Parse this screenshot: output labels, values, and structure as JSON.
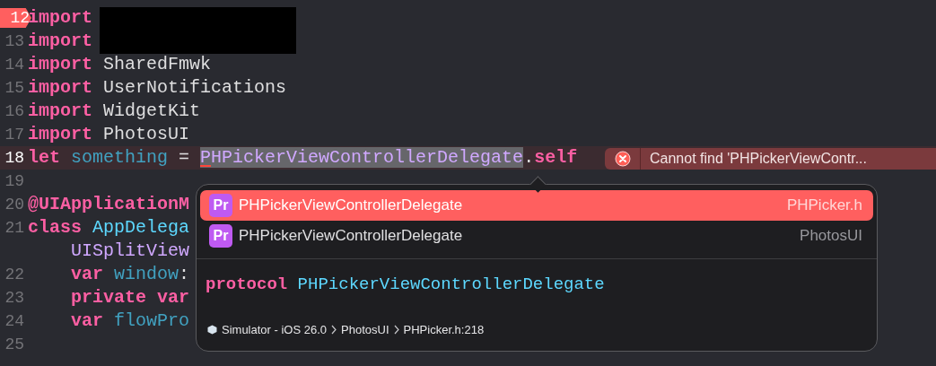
{
  "editor": {
    "lines": [
      {
        "number": "12",
        "marker": true,
        "highlighted": false,
        "tokens": [
          {
            "text": "import",
            "kind": "keyword"
          }
        ]
      },
      {
        "number": "13",
        "marker": false,
        "highlighted": false,
        "tokens": [
          {
            "text": "import",
            "kind": "keyword"
          }
        ]
      },
      {
        "number": "14",
        "marker": false,
        "highlighted": false,
        "tokens": [
          {
            "text": "import",
            "kind": "keyword"
          },
          {
            "text": " SharedFmwk",
            "kind": "plain"
          }
        ]
      },
      {
        "number": "15",
        "marker": false,
        "highlighted": false,
        "tokens": [
          {
            "text": "import",
            "kind": "keyword"
          },
          {
            "text": " UserNotifications",
            "kind": "plain"
          }
        ]
      },
      {
        "number": "16",
        "marker": false,
        "highlighted": false,
        "tokens": [
          {
            "text": "import",
            "kind": "keyword"
          },
          {
            "text": " WidgetKit",
            "kind": "plain"
          }
        ]
      },
      {
        "number": "17",
        "marker": false,
        "highlighted": false,
        "tokens": [
          {
            "text": "import",
            "kind": "keyword"
          },
          {
            "text": " PhotosUI",
            "kind": "plain"
          }
        ]
      },
      {
        "number": "18",
        "marker": false,
        "highlighted": true,
        "tokens": [
          {
            "text": "let",
            "kind": "keyword"
          },
          {
            "text": " something",
            "kind": "identifier"
          },
          {
            "text": " = ",
            "kind": "plain"
          },
          {
            "text": "PHPickerViewControllerDelegate",
            "kind": "selected-type"
          },
          {
            "text": ".",
            "kind": "plain"
          },
          {
            "text": "self",
            "kind": "keyword"
          }
        ]
      },
      {
        "number": "19",
        "marker": false,
        "highlighted": false
      },
      {
        "number": "20",
        "marker": false,
        "highlighted": false,
        "tokens": [
          {
            "text": "@UIApplicationM",
            "kind": "keyword"
          }
        ]
      },
      {
        "number": "21",
        "marker": false,
        "highlighted": false,
        "tokens": [
          {
            "text": "class",
            "kind": "keyword"
          },
          {
            "text": " AppDelega",
            "kind": "class-name"
          }
        ]
      },
      {
        "marker": false,
        "highlighted": false,
        "tokens": [
          {
            "text": "    UISplitView",
            "kind": "type"
          }
        ]
      },
      {
        "number": "22",
        "marker": false,
        "highlighted": false,
        "tokens": [
          {
            "text": "    var",
            "kind": "keyword"
          },
          {
            "text": " window",
            "kind": "identifier"
          },
          {
            "text": ":",
            "kind": "plain"
          }
        ]
      },
      {
        "number": "23",
        "marker": false,
        "highlighted": false,
        "tokens": [
          {
            "text": "    private var",
            "kind": "keyword"
          }
        ]
      },
      {
        "number": "24",
        "marker": false,
        "highlighted": false,
        "tokens": [
          {
            "text": "    var",
            "kind": "keyword"
          },
          {
            "text": " flowPro",
            "kind": "identifier"
          }
        ]
      },
      {
        "number": "25",
        "marker": false,
        "highlighted": false
      }
    ]
  },
  "error": {
    "message": "Cannot find 'PHPickerViewContr..."
  },
  "completion": {
    "items": [
      {
        "badge": "Pr",
        "name": "PHPickerViewControllerDelegate",
        "source": "PHPicker.h",
        "selected": true
      },
      {
        "badge": "Pr",
        "name": "PHPickerViewControllerDelegate",
        "source": "PhotosUI",
        "selected": false
      }
    ],
    "declaration": [
      {
        "text": "protocol",
        "kind": "keyword"
      },
      {
        "text": " PHPickerViewControllerDelegate",
        "kind": "class-name"
      }
    ],
    "path": [
      "Simulator - iOS 26.0",
      "PhotosUI",
      "PHPicker.h:218"
    ]
  }
}
